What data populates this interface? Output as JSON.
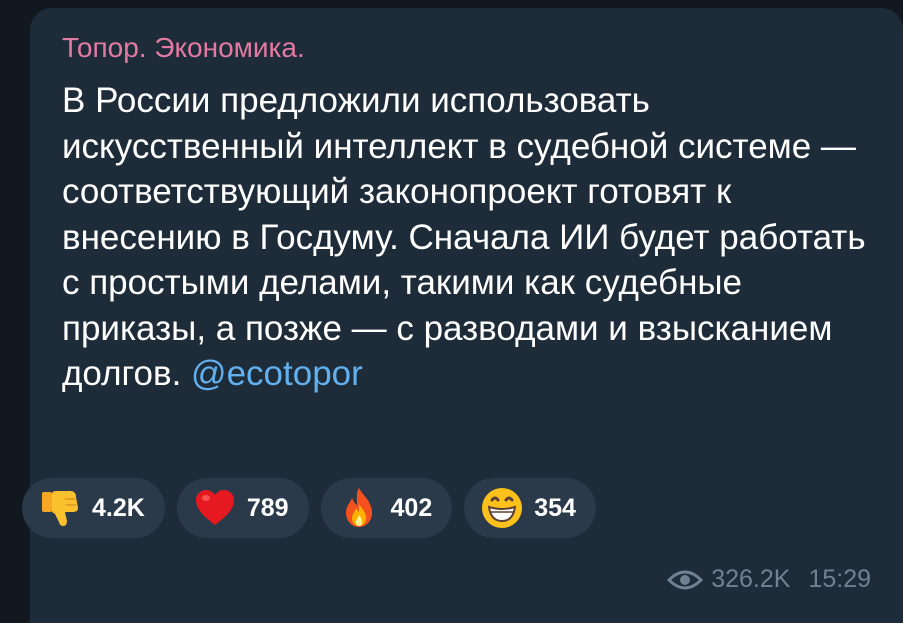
{
  "post": {
    "channel_name": "Топор. Экономика.",
    "text": "В России предложили использовать искусственный интеллект в судебной системе — соответствующий законопроект готовят к внесению в Госдуму. Сначала ИИ будет работать с простыми делами, такими как судебные приказы, а позже — с разводами и взысканием долгов. ",
    "mention": "@ecotopor",
    "views": "326.2K",
    "time": "15:29"
  },
  "reactions": [
    {
      "icon": "thumbs-down-icon",
      "count": "4.2K"
    },
    {
      "icon": "heart-icon",
      "count": "789"
    },
    {
      "icon": "fire-icon",
      "count": "402"
    },
    {
      "icon": "grinning-face-icon",
      "count": "354"
    }
  ],
  "colors": {
    "channel_name": "#e37aa2",
    "mention": "#62b0ee",
    "bubble": "#1e2c3a",
    "reaction_bg": "#2b3a4a",
    "meta": "#6f8192"
  }
}
